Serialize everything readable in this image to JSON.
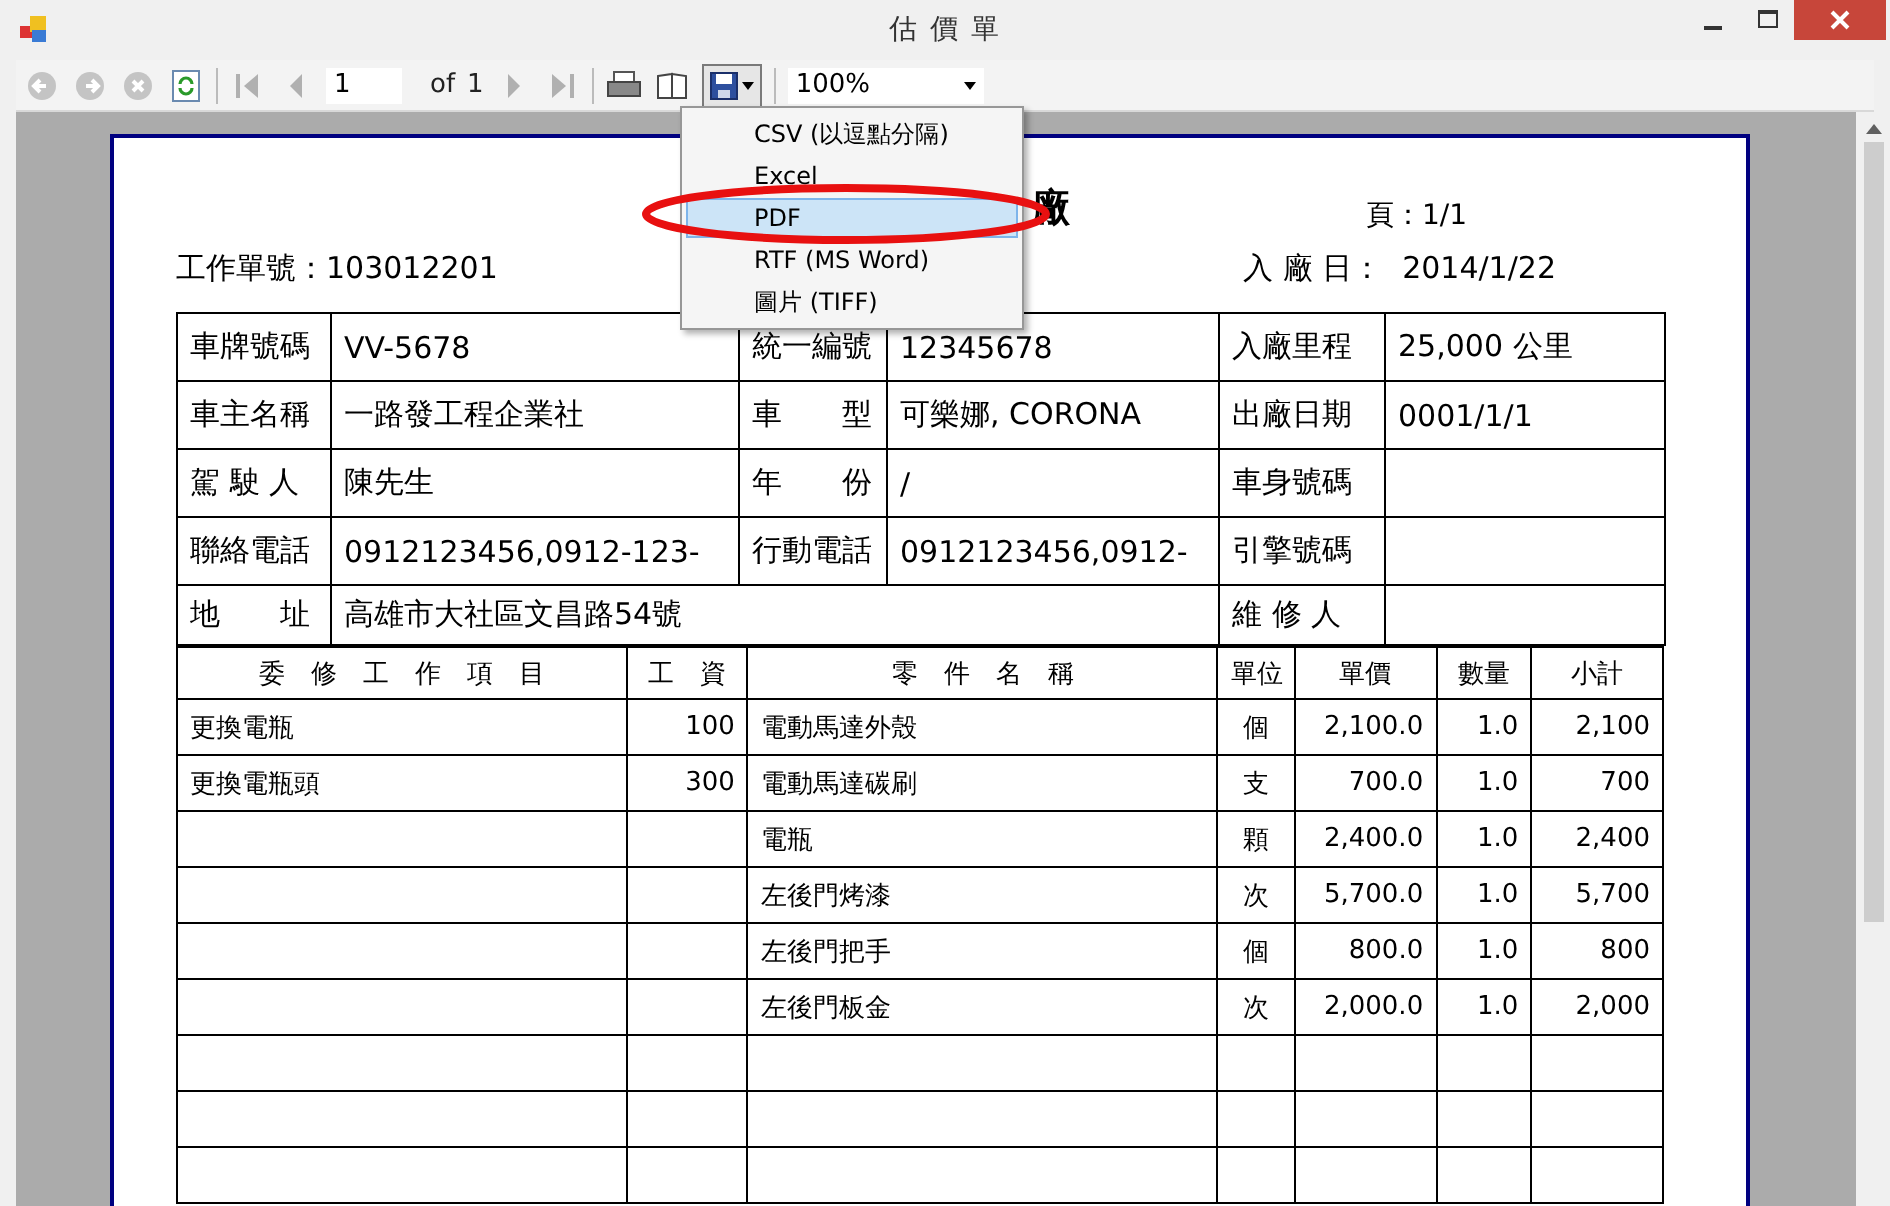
{
  "window": {
    "title": "估 價 單"
  },
  "toolbar": {
    "page_input": "1",
    "of_label": "of",
    "page_count": "1",
    "zoom": "100%",
    "export_open": true
  },
  "export_menu": [
    {
      "label": "CSV (以逗點分隔)",
      "selected": false
    },
    {
      "label": "Excel",
      "selected": false
    },
    {
      "label": "PDF",
      "selected": true
    },
    {
      "label": "RTF (MS Word)",
      "selected": false
    },
    {
      "label": "圖片 (TIFF)",
      "selected": false
    }
  ],
  "report": {
    "title": "廠",
    "page": "頁：1/1",
    "order_no": "工作單號：103012201",
    "entry_date_label": "入 廠 日：",
    "entry_date": "2014/1/22",
    "info_rows": [
      {
        "cells": [
          "車牌號碼",
          "VV-5678",
          "統一編號",
          "12345678",
          "入廠里程",
          "25,000 公里"
        ]
      },
      {
        "cells": [
          "車主名稱",
          "一路發工程企業社",
          "車　　型",
          "可樂娜, CORONA",
          "出廠日期",
          "0001/1/1"
        ]
      },
      {
        "cells": [
          "駕 駛 人",
          "陳先生",
          "年　　份",
          "/",
          "車身號碼",
          null
        ]
      },
      {
        "cells": [
          "聯絡電話",
          "0912123456,0912-123-",
          "行動電話",
          "0912123456,0912-",
          "引擎號碼",
          null
        ]
      },
      {
        "cells": [
          "地　　址",
          "高雄市大社區文昌路54號",
          null,
          null,
          "維 修 人",
          null
        ]
      }
    ],
    "item_columns": [
      "委　修　工　作　項　目",
      "工　資",
      "零　件　名　稱",
      "單位",
      "單價",
      "數量",
      "小計"
    ],
    "item_rows": [
      {
        "cells": [
          "更換電瓶",
          "100",
          "電動馬達外殼",
          "個",
          "2,100.0",
          "1.0",
          "2,100"
        ]
      },
      {
        "cells": [
          "更換電瓶頭",
          "300",
          "電動馬達碳刷",
          "支",
          "700.0",
          "1.0",
          "700"
        ]
      },
      {
        "cells": [
          null,
          null,
          "電瓶",
          "顆",
          "2,400.0",
          "1.0",
          "2,400"
        ]
      },
      {
        "cells": [
          null,
          null,
          "左後門烤漆",
          "次",
          "5,700.0",
          "1.0",
          "5,700"
        ]
      },
      {
        "cells": [
          null,
          null,
          "左後門把手",
          "個",
          "800.0",
          "1.0",
          "800"
        ]
      },
      {
        "cells": [
          null,
          null,
          "左後門板金",
          "次",
          "2,000.0",
          "1.0",
          "2,000"
        ]
      },
      {
        "cells": [
          null,
          null,
          null,
          null,
          null,
          null,
          null
        ]
      },
      {
        "cells": [
          null,
          null,
          null,
          null,
          null,
          null,
          null
        ]
      },
      {
        "cells": [
          null,
          null,
          null,
          null,
          null,
          null,
          null
        ]
      }
    ]
  }
}
